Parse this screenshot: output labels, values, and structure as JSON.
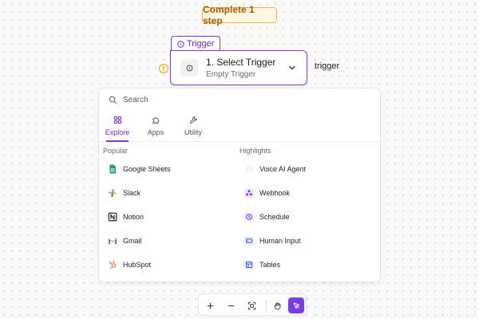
{
  "badge": {
    "text": "Complete 1 step"
  },
  "trigger": {
    "tab_label": "Trigger",
    "title": "1. Select Trigger",
    "subtitle": "Empty Trigger",
    "side_label": "trigger",
    "warning_glyph": "!"
  },
  "panel": {
    "search": {
      "placeholder": "Search",
      "value": ""
    },
    "tabs": [
      {
        "label": "Explore",
        "icon": "grid-icon",
        "active": true
      },
      {
        "label": "Apps",
        "icon": "puzzle-icon",
        "active": false
      },
      {
        "label": "Utility",
        "icon": "wrench-icon",
        "active": false
      }
    ],
    "popular": {
      "heading": "Popular",
      "items": [
        {
          "label": "Google Sheets",
          "icon": "google-sheets-icon"
        },
        {
          "label": "Slack",
          "icon": "slack-icon"
        },
        {
          "label": "Notion",
          "icon": "notion-icon"
        },
        {
          "label": "Gmail",
          "icon": "gmail-icon"
        },
        {
          "label": "HubSpot",
          "icon": "hubspot-icon"
        }
      ]
    },
    "highlights": {
      "heading": "Highlights",
      "items": [
        {
          "label": "Voice AI Agent",
          "icon": "voice-ai-icon"
        },
        {
          "label": "Webhook",
          "icon": "webhook-icon"
        },
        {
          "label": "Schedule",
          "icon": "schedule-icon"
        },
        {
          "label": "Human Input",
          "icon": "human-input-icon"
        },
        {
          "label": "Tables",
          "icon": "tables-icon"
        }
      ]
    }
  },
  "toolbar": {
    "tools": [
      {
        "icon": "zoom-in-icon"
      },
      {
        "icon": "zoom-out-icon"
      },
      {
        "icon": "fit-view-icon"
      },
      {
        "icon": "hand-pan-icon"
      },
      {
        "icon": "select-pointer-icon",
        "active": true
      }
    ]
  },
  "colors": {
    "accent": "#7c3aed",
    "badge_border": "#f0b33b",
    "badge_text": "#b25a00",
    "warning": "#e0a21a"
  }
}
